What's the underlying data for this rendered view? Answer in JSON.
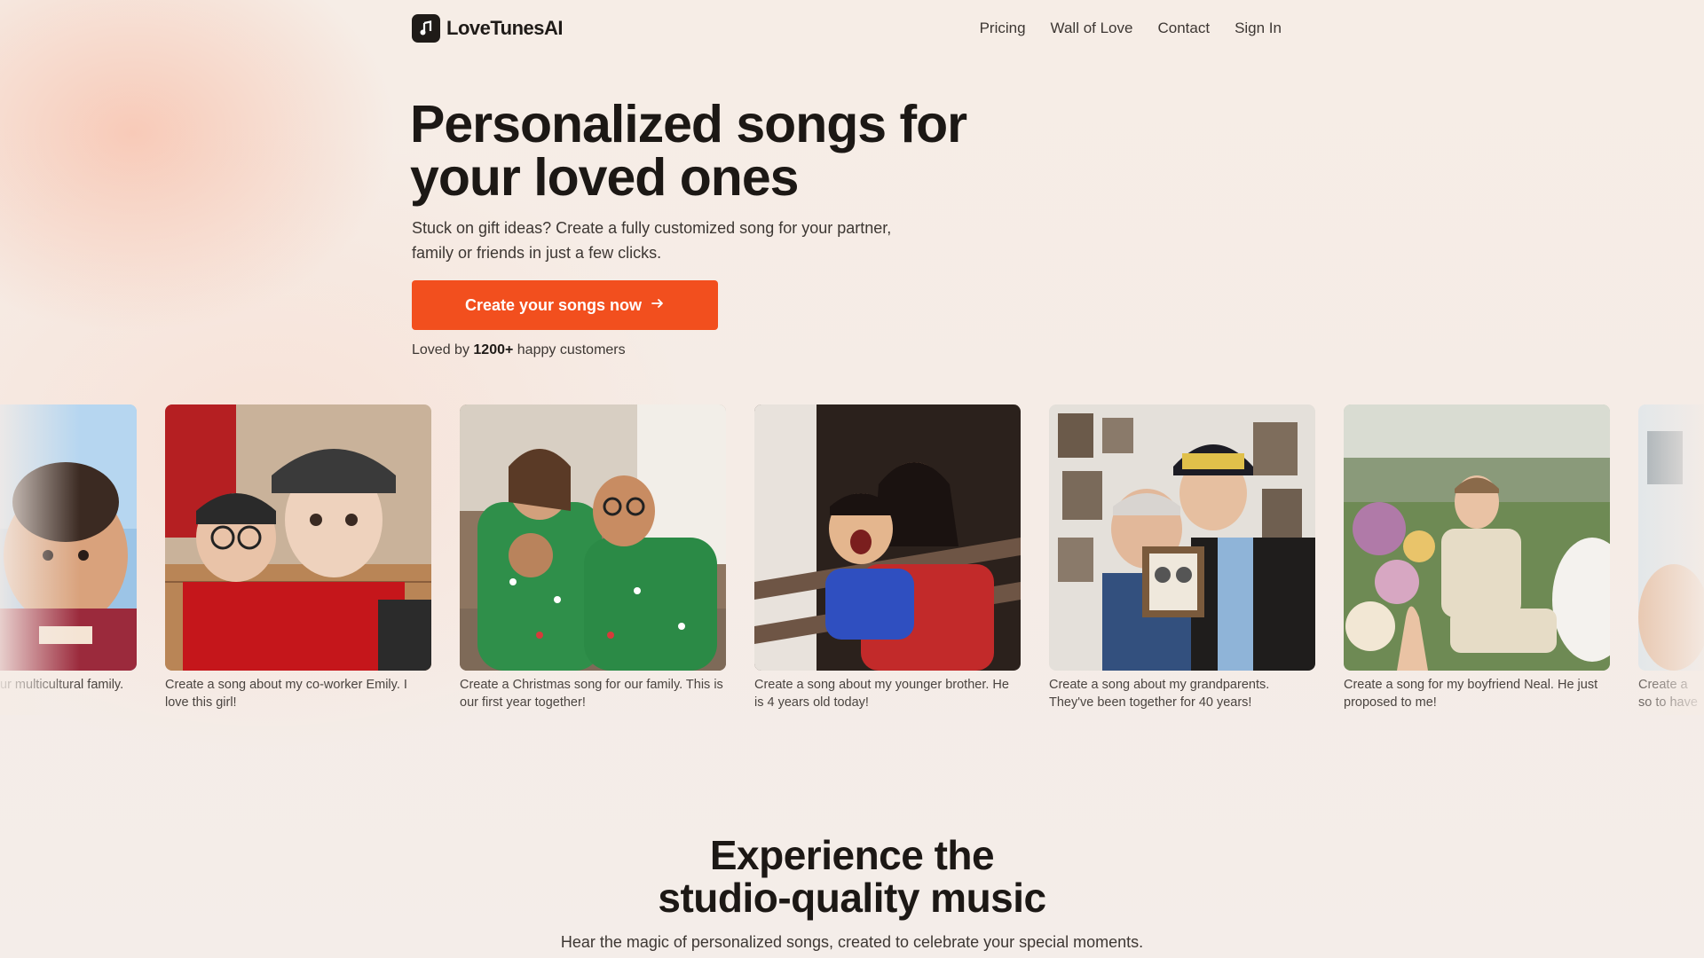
{
  "nav": {
    "brand": "LoveTunesAI",
    "links": [
      "Pricing",
      "Wall of Love",
      "Contact",
      "Sign In"
    ]
  },
  "hero": {
    "title_line1": "Personalized songs for",
    "title_line2": "your loved ones",
    "subtitle": "Stuck on gift ideas? Create a fully customized song for your partner, family or friends in just a few clicks.",
    "cta_label": "Create your songs now",
    "loved_prefix": "Loved by",
    "loved_count": "1200+",
    "loved_suffix": "happy customers"
  },
  "cards": [
    {
      "caption": "ur multicultural family."
    },
    {
      "caption": "Create a song about my co-worker Emily. I love this girl!"
    },
    {
      "caption": "Create a Christmas song for our family. This is our first year together!"
    },
    {
      "caption": "Create a song about my younger brother. He is 4 years old today!"
    },
    {
      "caption": "Create a song about my grandparents. They've been together for 40 years!"
    },
    {
      "caption": "Create a song for my boyfriend Neal. He just proposed to me!"
    },
    {
      "caption": "Create a so to have a"
    }
  ],
  "section": {
    "title_line1": "Experience the",
    "title_line2": "studio-quality music",
    "subtitle": "Hear the magic of personalized songs, created to celebrate your special moments."
  },
  "colors": {
    "accent": "#f24f1e",
    "text": "#1f1b18",
    "background": "#f5ece6"
  }
}
